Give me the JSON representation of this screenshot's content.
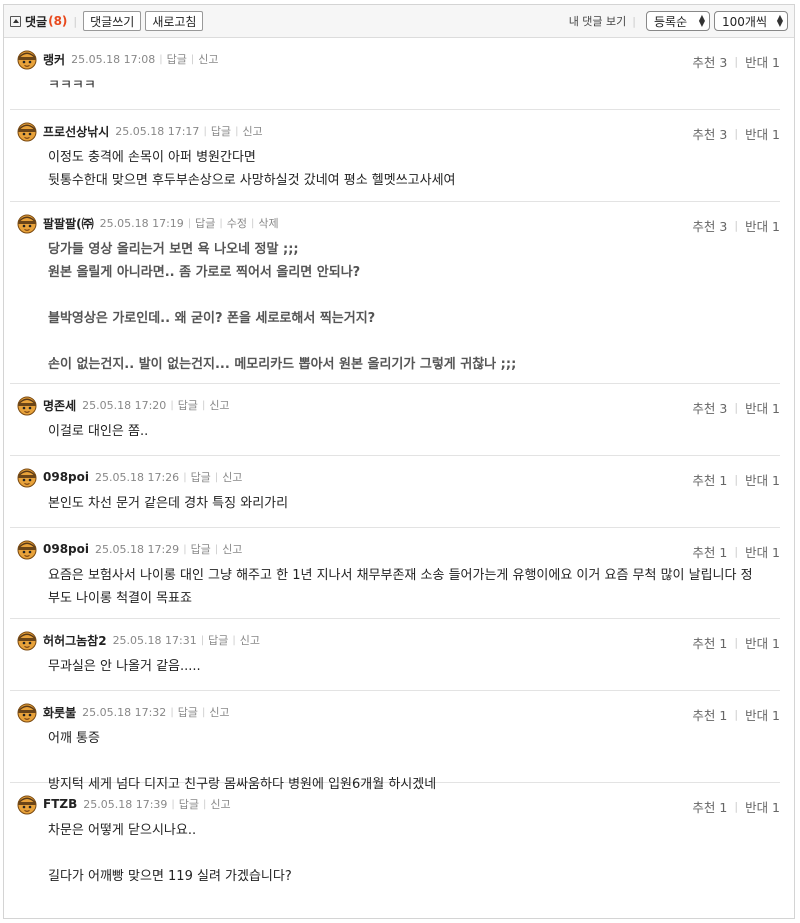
{
  "header": {
    "title": "댓글",
    "count": "(8)",
    "write_button": "댓글쓰기",
    "refresh_button": "새로고침",
    "my_comments": "내 댓글 보기",
    "order_select": "등록순",
    "count_select": "100개씩"
  },
  "comments": [
    {
      "nick": "랭커",
      "date": "25.05.18 17:08",
      "actions": [
        "답글",
        "신고"
      ],
      "up": "추천 3",
      "down": "반대 1",
      "lines": [
        "ㅋㅋㅋㅋ"
      ],
      "bold": false
    },
    {
      "nick": "프로선상낚시",
      "date": "25.05.18 17:17",
      "actions": [
        "답글",
        "신고"
      ],
      "up": "추천 3",
      "down": "반대 1",
      "lines": [
        "이정도 충격에 손목이 아퍼 병원간다면",
        "뒷통수한대 맞으면 후두부손상으로 사망하실것 갔네여 평소 헬멧쓰고사세여"
      ],
      "bold": false
    },
    {
      "nick": "팔팔팔(㈜",
      "date": "25.05.18 17:19",
      "actions": [
        "답글",
        "수정",
        "삭제"
      ],
      "up": "추천 3",
      "down": "반대 1",
      "lines": [
        "당가들 영상 올리는거 보면 욕 나오네 정말 ;;;",
        "원본 올릴게 아니라면.. 좀 가로로 찍어서 올리면 안되나?",
        "",
        "블박영상은 가로인데.. 왜 굳이? 폰을 세로로해서 찍는거지?",
        "",
        "손이 없는건지.. 발이 없는건지... 메모리카드 뽑아서 원본 올리기가 그렇게 귀찮나 ;;;"
      ],
      "bold": true
    },
    {
      "nick": "명존세",
      "date": "25.05.18 17:20",
      "actions": [
        "답글",
        "신고"
      ],
      "up": "추천 3",
      "down": "반대 1",
      "lines": [
        "이걸로 대인은 쫌.."
      ],
      "bold": false
    },
    {
      "nick": "098poi",
      "date": "25.05.18 17:26",
      "actions": [
        "답글",
        "신고"
      ],
      "up": "추천 1",
      "down": "반대 1",
      "lines": [
        "본인도 차선 문거 같은데 경차 특징 와리가리"
      ],
      "bold": false
    },
    {
      "nick": "098poi",
      "date": "25.05.18 17:29",
      "actions": [
        "답글",
        "신고"
      ],
      "up": "추천 1",
      "down": "반대 1",
      "lines": [
        "요즘은 보험사서 나이롱 대인 그냥 해주고 한 1년 지나서 채무부존재 소송 들어가는게 유행이에요 이거 요즘 무척 많이 날립니다 정",
        "부도 나이롱 척결이 목표죠"
      ],
      "bold": false
    },
    {
      "nick": "허허그놈참2",
      "date": "25.05.18 17:31",
      "actions": [
        "답글",
        "신고"
      ],
      "up": "추천 1",
      "down": "반대 1",
      "lines": [
        "무과실은 안 나올거 같음....."
      ],
      "bold": false
    },
    {
      "nick": "화룻불",
      "date": "25.05.18 17:32",
      "actions": [
        "답글",
        "신고"
      ],
      "up": "추천 1",
      "down": "반대 1",
      "lines": [
        "어깨 통증",
        "",
        "방지턱 세게 넘다 디지고 친구랑 몸싸움하다 병원에 입원6개월 하시겠네"
      ],
      "bold": false
    },
    {
      "nick": "FTZB",
      "date": "25.05.18 17:39",
      "actions": [
        "답글",
        "신고"
      ],
      "up": "추천 1",
      "down": "반대 1",
      "lines": [
        "차문은 어떻게 닫으시나요..",
        "",
        "길다가 어깨빵 맞으면 119 실려 가겠습니다?"
      ],
      "bold": false
    }
  ]
}
